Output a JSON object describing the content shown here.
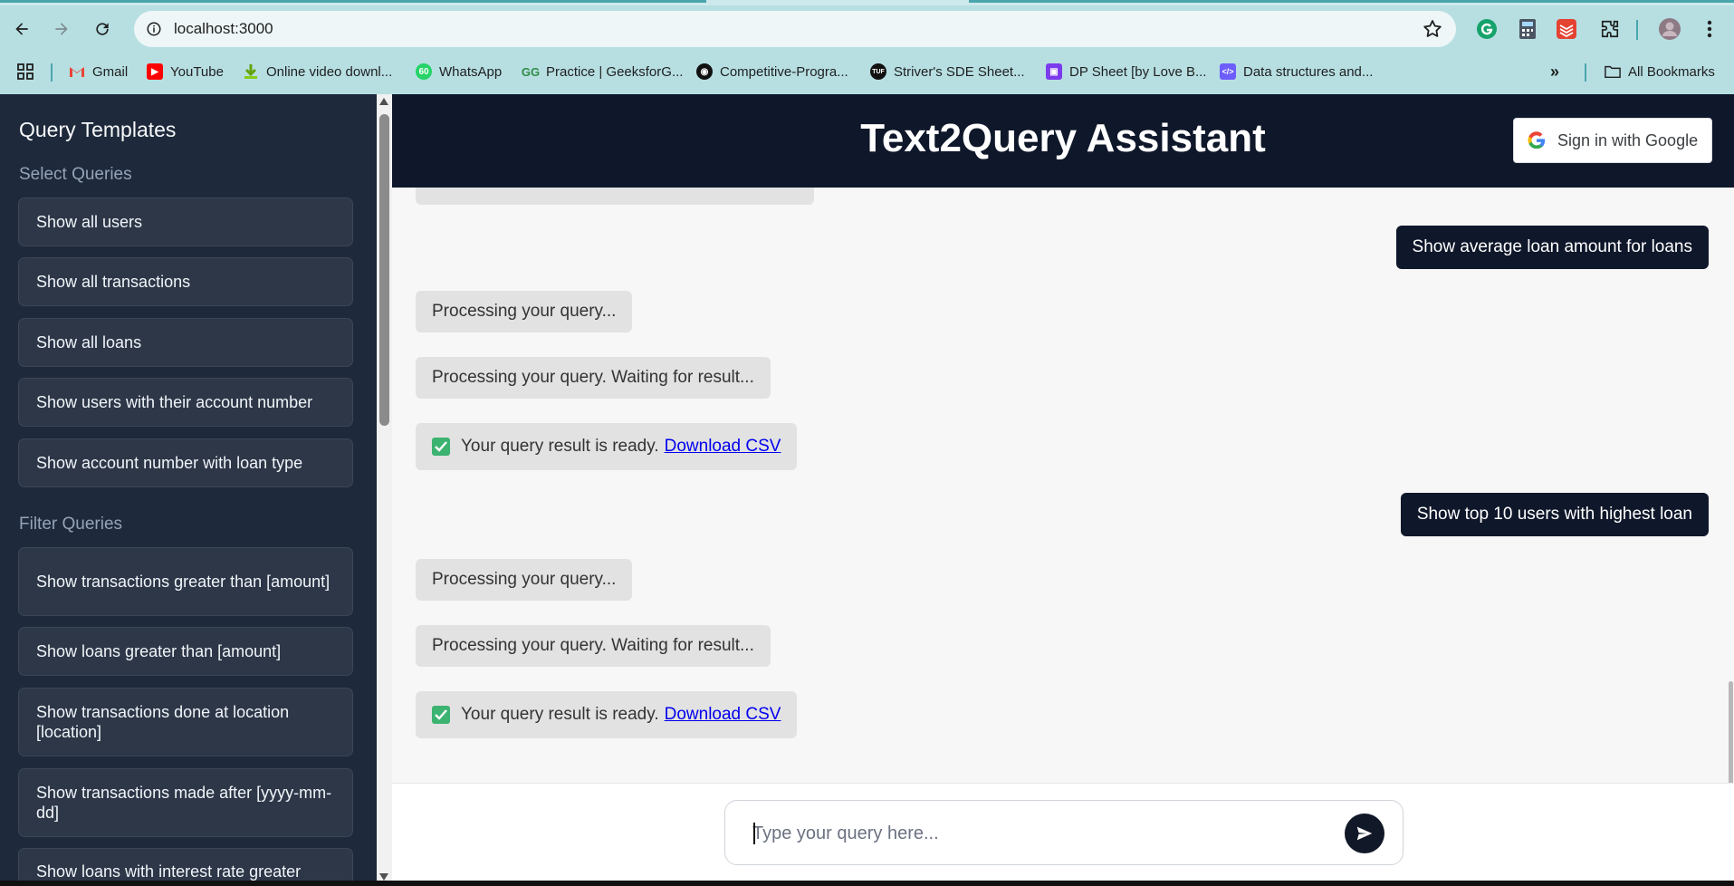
{
  "browser": {
    "url": "localhost:3000",
    "bookmarks": [
      {
        "label": "Gmail",
        "icon": "gmail-icon"
      },
      {
        "label": "YouTube",
        "icon": "youtube-icon"
      },
      {
        "label": "Online video downl...",
        "icon": "download-icon"
      },
      {
        "label": "WhatsApp",
        "icon": "whatsapp-icon"
      },
      {
        "label": "Practice | GeeksforG...",
        "icon": "geeksforgeeks-icon"
      },
      {
        "label": "Competitive-Progra...",
        "icon": "github-icon"
      },
      {
        "label": "Striver's SDE Sheet...",
        "icon": "tuf-icon"
      },
      {
        "label": "DP Sheet [by Love B...",
        "icon": "presentation-icon"
      },
      {
        "label": "Data structures and...",
        "icon": "code-icon"
      }
    ],
    "all_bookmarks": "All Bookmarks",
    "colors": {
      "chrome": "#b7dfe2",
      "accent": "#4aa6ad"
    }
  },
  "sidebar": {
    "title": "Query Templates",
    "select_title": "Select Queries",
    "select_items": [
      "Show all users",
      "Show all transactions",
      "Show all loans",
      "Show users with their account number",
      "Show account number with loan type"
    ],
    "filter_title": "Filter Queries",
    "filter_items": [
      "Show transactions greater than [amount]",
      "Show loans greater than [amount]",
      "Show transactions done at location [location]",
      "Show transactions made after [yyyy-mm-dd]",
      "Show loans with interest rate greater"
    ]
  },
  "header": {
    "title": "Text2Query Assistant",
    "signin": "Sign in with Google"
  },
  "chat": {
    "messages": [
      {
        "role": "user",
        "text": "Show average loan amount for loans"
      },
      {
        "role": "bot",
        "text": "Processing your query..."
      },
      {
        "role": "bot",
        "text": "Processing your query. Waiting for result..."
      },
      {
        "role": "bot",
        "text": "Your query result is ready.",
        "link": "Download CSV"
      },
      {
        "role": "user",
        "text": "Show top 10 users with highest loan"
      },
      {
        "role": "bot",
        "text": "Processing your query..."
      },
      {
        "role": "bot",
        "text": "Processing your query. Waiting for result..."
      },
      {
        "role": "bot",
        "text": "Your query result is ready.",
        "link": "Download CSV"
      }
    ]
  },
  "input": {
    "placeholder": "Type your query here...",
    "value": ""
  }
}
